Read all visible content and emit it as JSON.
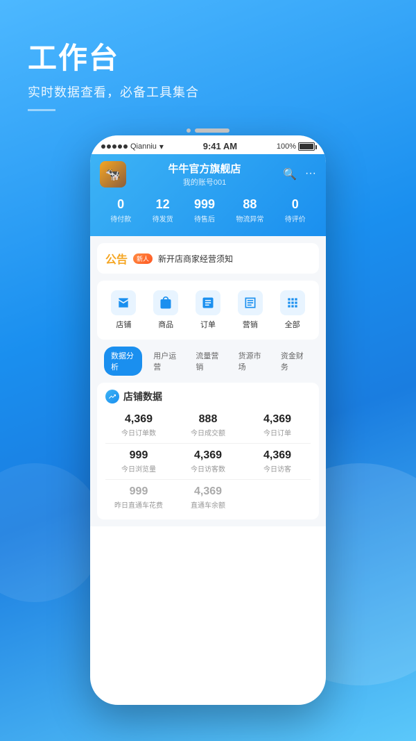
{
  "page": {
    "title": "工作台",
    "subtitle": "实时数据查看，必备工具集合"
  },
  "phone": {
    "signal_carrier": "Qianniu",
    "time": "9:41 AM",
    "battery": "100%",
    "shop": {
      "name": "牛牛官方旗舰店",
      "account": "我的账号001",
      "avatar_emoji": "👤"
    },
    "order_stats": [
      {
        "value": "0",
        "label": "待付款"
      },
      {
        "value": "12",
        "label": "待发货"
      },
      {
        "value": "999",
        "label": "待售后"
      },
      {
        "value": "88",
        "label": "物流异常"
      },
      {
        "value": "0",
        "label": "待评价"
      }
    ],
    "notice": {
      "icon": "公告",
      "badge": "新人",
      "text": "新开店商家经营须知"
    },
    "quick_icons": [
      {
        "icon": "🏪",
        "label": "店铺"
      },
      {
        "icon": "🛍",
        "label": "商品"
      },
      {
        "icon": "📋",
        "label": "订单"
      },
      {
        "icon": "📊",
        "label": "营销"
      },
      {
        "icon": "⚙️",
        "label": "全部"
      }
    ],
    "tabs": [
      {
        "label": "数据分析",
        "active": true
      },
      {
        "label": "用户运营",
        "active": false
      },
      {
        "label": "流量营销",
        "active": false
      },
      {
        "label": "货源市场",
        "active": false
      },
      {
        "label": "资金财务",
        "active": false
      }
    ],
    "data_section": {
      "title": "店铺数据",
      "icon": "📈",
      "items": [
        {
          "value": "4,369",
          "label": "今日订单数"
        },
        {
          "value": "888",
          "label": "今日成交额"
        },
        {
          "value": "4,369",
          "label": "今日订单"
        },
        {
          "value": "999",
          "label": "今日浏览量"
        },
        {
          "value": "4,369",
          "label": "今日访客数"
        },
        {
          "value": "4,369",
          "label": "今日访客"
        },
        {
          "value": "999",
          "label": "昨日直通车花费"
        },
        {
          "value": "4,369",
          "label": "直通车余额"
        }
      ]
    }
  }
}
